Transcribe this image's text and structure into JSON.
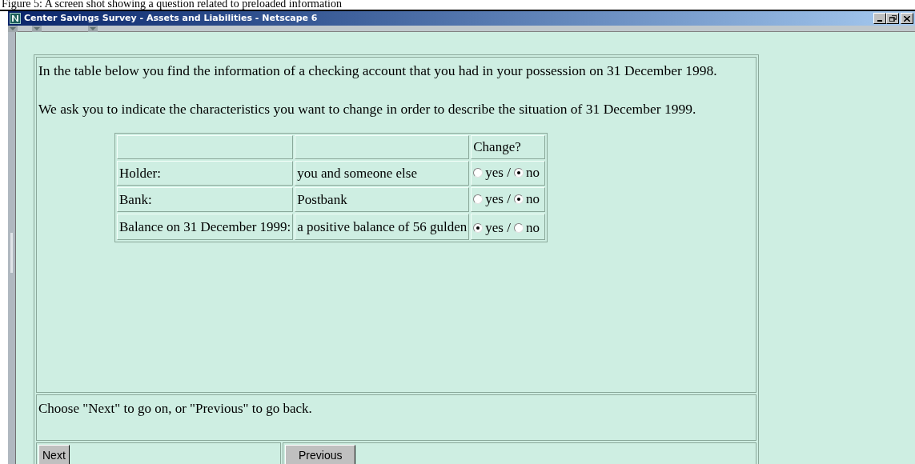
{
  "caption": "Figure 5: A screen shot showing a question related to preloaded information",
  "window": {
    "title": "Center Savings Survey - Assets and Liabilities - Netscape 6"
  },
  "intro": [
    "In the table below you find the information of a checking account that you had in your possession on 31 December 1998.",
    "We ask you to indicate the characteristics you want to change in order to describe the situation of 31 December 1999."
  ],
  "table": {
    "header": "Change?",
    "rows": [
      {
        "label": "Holder:",
        "value": "you and someone else",
        "options": [
          {
            "label": "yes /",
            "selected": false
          },
          {
            "label": "no",
            "selected": true
          }
        ]
      },
      {
        "label": "Bank:",
        "value": "Postbank",
        "options": [
          {
            "label": "yes /",
            "selected": false
          },
          {
            "label": "no",
            "selected": true
          }
        ]
      },
      {
        "label": "Balance on 31 December 1999:",
        "value": "a positive balance of 56 gulden",
        "options": [
          {
            "label": "yes /",
            "selected": true
          },
          {
            "label": "no",
            "selected": false
          }
        ]
      }
    ]
  },
  "footer_text": "Choose \"Next\" to go on, or \"Previous\" to go back.",
  "buttons": [
    "Next",
    "Previous"
  ]
}
